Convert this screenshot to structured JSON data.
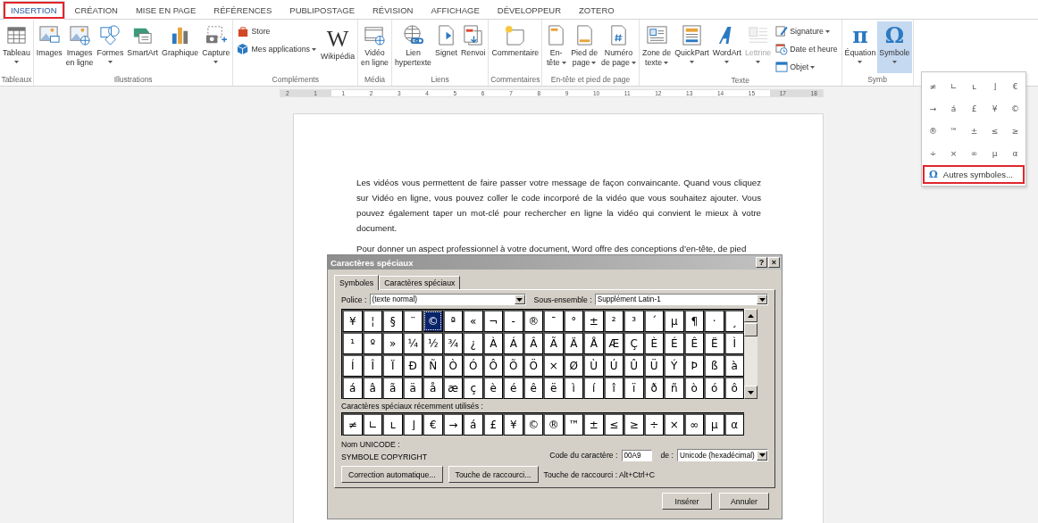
{
  "tabs": [
    {
      "label": "INSERTION",
      "selected": true,
      "highlighted": true
    },
    {
      "label": "CRÉATION",
      "selected": false,
      "highlighted": false
    },
    {
      "label": "MISE EN PAGE",
      "selected": false,
      "highlighted": false
    },
    {
      "label": "RÉFÉRENCES",
      "selected": false,
      "highlighted": false
    },
    {
      "label": "PUBLIPOSTAGE",
      "selected": false,
      "highlighted": false
    },
    {
      "label": "RÉVISION",
      "selected": false,
      "highlighted": false
    },
    {
      "label": "AFFICHAGE",
      "selected": false,
      "highlighted": false
    },
    {
      "label": "DÉVELOPPEUR",
      "selected": false,
      "highlighted": false
    },
    {
      "label": "ZOTERO",
      "selected": false,
      "highlighted": false
    }
  ],
  "ribbon": [
    {
      "label": "Tableaux",
      "items": [
        {
          "kind": "table",
          "lines": [
            "Tableau"
          ],
          "caret": true,
          "caret_inline": false
        }
      ]
    },
    {
      "label": "Illustrations",
      "items": [
        {
          "kind": "picture",
          "lines": [
            "Images"
          ],
          "caret": false
        },
        {
          "kind": "online-picture",
          "lines": [
            "Images",
            "en ligne"
          ],
          "caret": false
        },
        {
          "kind": "shapes",
          "lines": [
            "Formes"
          ],
          "caret": true,
          "caret_inline": false
        },
        {
          "kind": "smartart",
          "lines": [
            "SmartArt"
          ],
          "caret": false
        },
        {
          "kind": "chart",
          "lines": [
            "Graphique"
          ],
          "caret": false
        },
        {
          "kind": "screenshot",
          "lines": [
            "Capture"
          ],
          "caret": true,
          "caret_inline": false
        }
      ]
    },
    {
      "label": "Compléments",
      "items": [
        {
          "stack": [
            {
              "kind": "store",
              "label": "Store",
              "caret": false
            },
            {
              "kind": "apps",
              "label": "Mes applications",
              "caret": true
            }
          ]
        },
        {
          "logo": "W",
          "lines": [
            "Wikipédia"
          ],
          "caret": false
        }
      ]
    },
    {
      "label": "Média",
      "items": [
        {
          "kind": "video",
          "lines": [
            "Vidéo",
            "en ligne"
          ],
          "caret": false
        }
      ]
    },
    {
      "label": "Liens",
      "items": [
        {
          "kind": "link",
          "lines": [
            "Lien",
            "hypertexte"
          ],
          "caret": false
        },
        {
          "kind": "bookmark",
          "lines": [
            "Signet"
          ],
          "caret": false
        },
        {
          "kind": "cross-reference",
          "lines": [
            "Renvoi"
          ],
          "caret": false
        }
      ]
    },
    {
      "label": "Commentaires",
      "items": [
        {
          "kind": "comment",
          "lines": [
            "Commentaire"
          ],
          "caret": false
        }
      ]
    },
    {
      "label": "En-tête et pied de page",
      "items": [
        {
          "kind": "header",
          "lines": [
            "En-",
            "tête"
          ],
          "caret": true,
          "caret_inline": true
        },
        {
          "kind": "footer",
          "lines": [
            "Pied de",
            "page"
          ],
          "caret": true,
          "caret_inline": true
        },
        {
          "kind": "page-number",
          "lines": [
            "Numéro",
            "de page"
          ],
          "caret": true,
          "caret_inline": true
        }
      ]
    },
    {
      "label": "Texte",
      "items": [
        {
          "kind": "text-box",
          "lines": [
            "Zone de",
            "texte"
          ],
          "caret": true,
          "caret_inline": true,
          "disabled": false
        },
        {
          "kind": "quickpart",
          "lines": [
            "QuickPart"
          ],
          "caret": true,
          "caret_inline": false,
          "disabled": false
        },
        {
          "kind": "wordart",
          "lines": [
            "WordArt"
          ],
          "caret": true,
          "caret_inline": false,
          "disabled": false
        },
        {
          "kind": "dropcap",
          "lines": [
            "Lettrine"
          ],
          "caret": true,
          "caret_inline": false,
          "disabled": true
        },
        {
          "stack": [
            {
              "kind": "signature",
              "label": "Signature",
              "caret": true
            },
            {
              "kind": "date",
              "label": "Date et heure",
              "caret": false
            },
            {
              "kind": "object",
              "label": "Objet",
              "caret": true
            }
          ]
        }
      ]
    },
    {
      "label": "Symb",
      "items": [
        {
          "glyph": "π",
          "lines": [
            "Équation"
          ],
          "caret": true,
          "caret_inline": false,
          "pressed": false
        },
        {
          "glyph": "Ω",
          "lines": [
            "Symbole"
          ],
          "caret": true,
          "caret_inline": false,
          "pressed": true
        }
      ]
    }
  ],
  "ruler": [
    "2",
    "1",
    "1",
    "2",
    "3",
    "4",
    "5",
    "6",
    "7",
    "8",
    "9",
    "10",
    "11",
    "12",
    "13",
    "14",
    "15",
    "17",
    "18"
  ],
  "document": {
    "paragraphs": [
      "Les vidéos vous permettent de faire passer votre message de façon convaincante. Quand vous cliquez sur Vidéo en ligne, vous pouvez coller le code incorporé de la vidéo que vous souhaitez ajouter. Vous pouvez également taper un mot-clé pour rechercher en ligne la vidéo qui convient le mieux à votre document.",
      "Pour donner un aspect professionnel à votre document, Word offre des conceptions d’en-tête, de pied"
    ]
  },
  "symbol_menu": {
    "symbols": [
      "≠",
      "∟",
      "ʟ",
      "⌋",
      "€",
      "→",
      "á",
      "£",
      "¥",
      "©",
      "®",
      "™",
      "±",
      "≤",
      "≥",
      "÷",
      "×",
      "∞",
      "µ",
      "α"
    ],
    "more": {
      "glyph": "Ω",
      "label": "Autres symboles...",
      "highlighted": true
    }
  },
  "dialog": {
    "title": "Caractères spéciaux",
    "help": "?",
    "close": "×",
    "tabs": [
      {
        "label": "Symboles",
        "selected": true
      },
      {
        "label": "Caractères spéciaux",
        "selected": false
      }
    ],
    "font_label": "Police :",
    "font_value": "(texte normal)",
    "subset_label": "Sous-ensemble :",
    "subset_value": "Supplément Latin-1",
    "grid": [
      [
        {
          "c": "¥",
          "selected": false
        },
        {
          "c": "¦",
          "selected": false
        },
        {
          "c": "§",
          "selected": false
        },
        {
          "c": "¨",
          "selected": false
        },
        {
          "c": "©",
          "selected": true
        },
        {
          "c": "ª",
          "selected": false
        },
        {
          "c": "«",
          "selected": false
        },
        {
          "c": "¬",
          "selected": false
        },
        {
          "c": "-",
          "selected": false
        },
        {
          "c": "®",
          "selected": false
        },
        {
          "c": "¯",
          "selected": false
        },
        {
          "c": "°",
          "selected": false
        },
        {
          "c": "±",
          "selected": false
        },
        {
          "c": "²",
          "selected": false
        },
        {
          "c": "³",
          "selected": false
        },
        {
          "c": "´",
          "selected": false
        },
        {
          "c": "µ",
          "selected": false
        },
        {
          "c": "¶",
          "selected": false
        },
        {
          "c": "·",
          "selected": false
        },
        {
          "c": "¸",
          "selected": false
        }
      ],
      [
        {
          "c": "¹",
          "selected": false
        },
        {
          "c": "º",
          "selected": false
        },
        {
          "c": "»",
          "selected": false
        },
        {
          "c": "¼",
          "selected": false
        },
        {
          "c": "½",
          "selected": false
        },
        {
          "c": "¾",
          "selected": false
        },
        {
          "c": "¿",
          "selected": false
        },
        {
          "c": "À",
          "selected": false
        },
        {
          "c": "Á",
          "selected": false
        },
        {
          "c": "Â",
          "selected": false
        },
        {
          "c": "Ã",
          "selected": false
        },
        {
          "c": "Ä",
          "selected": false
        },
        {
          "c": "Å",
          "selected": false
        },
        {
          "c": "Æ",
          "selected": false
        },
        {
          "c": "Ç",
          "selected": false
        },
        {
          "c": "È",
          "selected": false
        },
        {
          "c": "É",
          "selected": false
        },
        {
          "c": "Ê",
          "selected": false
        },
        {
          "c": "Ë",
          "selected": false
        },
        {
          "c": "Ì",
          "selected": false
        }
      ],
      [
        {
          "c": "Í",
          "selected": false
        },
        {
          "c": "Î",
          "selected": false
        },
        {
          "c": "Ï",
          "selected": false
        },
        {
          "c": "Ð",
          "selected": false
        },
        {
          "c": "Ñ",
          "selected": false
        },
        {
          "c": "Ò",
          "selected": false
        },
        {
          "c": "Ó",
          "selected": false
        },
        {
          "c": "Ô",
          "selected": false
        },
        {
          "c": "Õ",
          "selected": false
        },
        {
          "c": "Ö",
          "selected": false
        },
        {
          "c": "×",
          "selected": false
        },
        {
          "c": "Ø",
          "selected": false
        },
        {
          "c": "Ù",
          "selected": false
        },
        {
          "c": "Ú",
          "selected": false
        },
        {
          "c": "Û",
          "selected": false
        },
        {
          "c": "Ü",
          "selected": false
        },
        {
          "c": "Ý",
          "selected": false
        },
        {
          "c": "Þ",
          "selected": false
        },
        {
          "c": "ß",
          "selected": false
        },
        {
          "c": "à",
          "selected": false
        }
      ],
      [
        {
          "c": "á",
          "selected": false
        },
        {
          "c": "â",
          "selected": false
        },
        {
          "c": "ã",
          "selected": false
        },
        {
          "c": "ä",
          "selected": false
        },
        {
          "c": "å",
          "selected": false
        },
        {
          "c": "æ",
          "selected": false
        },
        {
          "c": "ç",
          "selected": false
        },
        {
          "c": "è",
          "selected": false
        },
        {
          "c": "é",
          "selected": false
        },
        {
          "c": "ê",
          "selected": false
        },
        {
          "c": "ë",
          "selected": false
        },
        {
          "c": "ì",
          "selected": false
        },
        {
          "c": "í",
          "selected": false
        },
        {
          "c": "î",
          "selected": false
        },
        {
          "c": "ï",
          "selected": false
        },
        {
          "c": "ð",
          "selected": false
        },
        {
          "c": "ñ",
          "selected": false
        },
        {
          "c": "ò",
          "selected": false
        },
        {
          "c": "ó",
          "selected": false
        },
        {
          "c": "ô",
          "selected": false
        }
      ]
    ],
    "recent_label": "Caractères spéciaux récemment utilisés :",
    "recent": [
      "≠",
      "∟",
      "ʟ",
      "⌋",
      "€",
      "→",
      "á",
      "£",
      "¥",
      "©",
      "®",
      "™",
      "±",
      "≤",
      "≥",
      "÷",
      "×",
      "∞",
      "µ",
      "α"
    ],
    "unicode_label": "Nom UNICODE :",
    "unicode_name": "SYMBOLE COPYRIGHT",
    "code_label": "Code du caractère :",
    "code_value": "00A9",
    "from_label": "de :",
    "from_value": "Unicode (hexadécimal)",
    "autocorrect": "Correction automatique...",
    "shortcut_button": "Touche de raccourci...",
    "shortcut_text": "Touche de raccourci : Alt+Ctrl+C",
    "insert": "Insérer",
    "cancel": "Annuler"
  }
}
